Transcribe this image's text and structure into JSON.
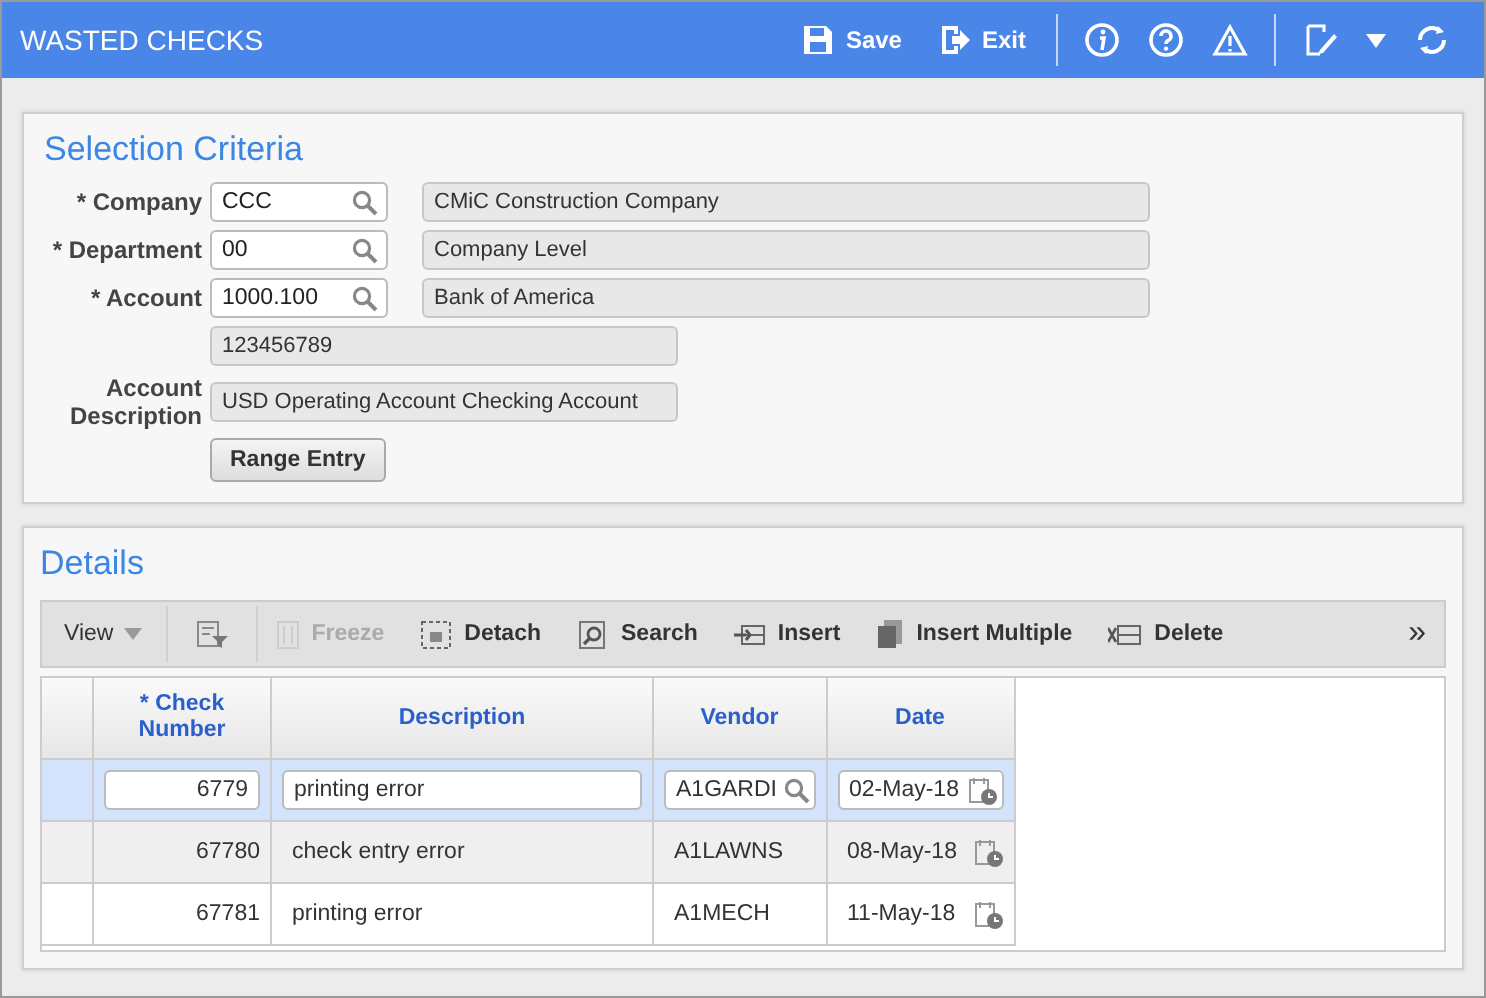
{
  "window": {
    "title": "WASTED CHECKS"
  },
  "header_actions": [
    {
      "kind": "save",
      "label": "Save"
    },
    {
      "kind": "exit",
      "label": "Exit"
    },
    {
      "kind": "info"
    },
    {
      "kind": "help"
    },
    {
      "kind": "warning"
    },
    {
      "kind": "edit"
    },
    {
      "kind": "caret"
    },
    {
      "kind": "refresh"
    }
  ],
  "selection_criteria": {
    "title": "Selection Criteria",
    "fields": [
      {
        "label": "* Company",
        "value": "CCC",
        "description": "CMiC Construction Company"
      },
      {
        "label": "* Department",
        "value": "00",
        "description": "Company Level"
      },
      {
        "label": "* Account",
        "value": "1000.100",
        "description": "Bank of America"
      }
    ],
    "account_number": "123456789",
    "account_description": {
      "label": "Account Description",
      "value": "USD Operating Account Checking Account"
    },
    "range_button": "Range Entry"
  },
  "details": {
    "title": "Details",
    "toolbar": [
      {
        "kind": "view",
        "label": "View",
        "disabled": false
      },
      {
        "kind": "filter",
        "disabled": false
      },
      {
        "kind": "freeze",
        "label": "Freeze",
        "disabled": true
      },
      {
        "kind": "detach",
        "label": "Detach",
        "disabled": false
      },
      {
        "kind": "search",
        "label": "Search",
        "disabled": false
      },
      {
        "kind": "insert",
        "label": "Insert",
        "disabled": false
      },
      {
        "kind": "insert-multiple",
        "label": "Insert Multiple",
        "disabled": false
      },
      {
        "kind": "delete",
        "label": "Delete",
        "disabled": false
      }
    ],
    "overflow": "»",
    "columns": [
      "* Check Number",
      "Description",
      "Vendor",
      "Date"
    ],
    "rows": [
      {
        "selected": true,
        "check": "6779",
        "description": "printing error",
        "vendor": "A1GARDI",
        "date": "02-May-18"
      },
      {
        "selected": false,
        "check": "67780",
        "description": "check entry error",
        "vendor": "A1LAWNS",
        "date": "08-May-18"
      },
      {
        "selected": false,
        "check": "67781",
        "description": "printing error",
        "vendor": "A1MECH",
        "date": "11-May-18"
      }
    ]
  }
}
